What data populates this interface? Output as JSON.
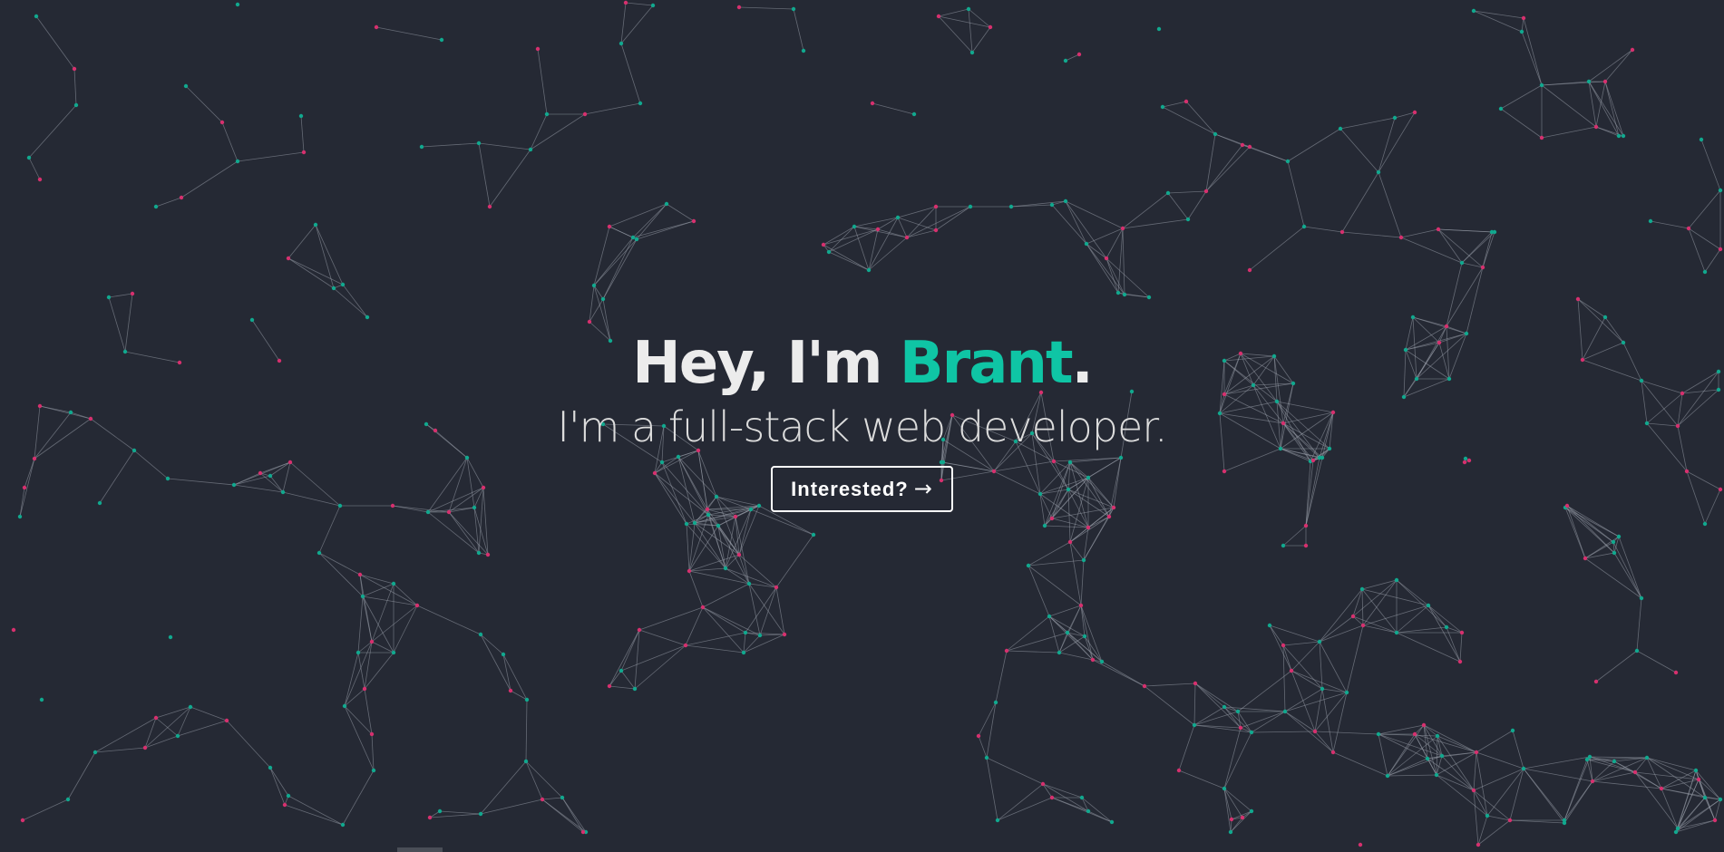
{
  "hero": {
    "greeting": "Hey, I'm ",
    "name": "Brant",
    "period": ".",
    "subtitle": "I'm a full-stack web developer.",
    "cta_label": "Interested?",
    "cta_arrow": "→"
  },
  "theme": {
    "background": "#252934",
    "accent": "#0fc5a5",
    "particle_pink": "#d6306e",
    "particle_teal": "#11a88e",
    "line_color": "#9aa0ab"
  },
  "icons": {
    "cta_arrow": "right-arrow-icon",
    "background": "particle-network-animation"
  }
}
